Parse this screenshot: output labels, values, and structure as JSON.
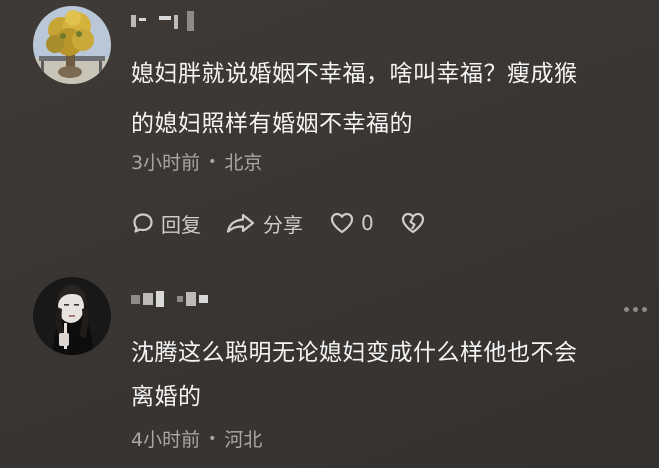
{
  "comments": [
    {
      "text_line1": "媳妇胖就说婚姻不幸福，啥叫幸福？瘦成猴",
      "text_line2": "的媳妇照样有婚姻不幸福的",
      "time": "3小时前",
      "separator": "•",
      "location": "北京",
      "actions": {
        "reply_label": "回复",
        "share_label": "分享",
        "like_count": "0"
      }
    },
    {
      "text_line1": "沈腾这么聪明无论媳妇变成什么样他也不会",
      "text_line2": "离婚的",
      "time": "4小时前",
      "separator": "•",
      "location": "河北"
    }
  ],
  "icons": {
    "reply": "chat-bubble-icon",
    "share": "share-arrow-icon",
    "like": "heart-icon",
    "dislike": "broken-heart-icon",
    "more": "more-dots-icon"
  },
  "colors": {
    "background": "#3a3633",
    "text": "#f4f4f4",
    "meta": "#a9a6a3"
  }
}
